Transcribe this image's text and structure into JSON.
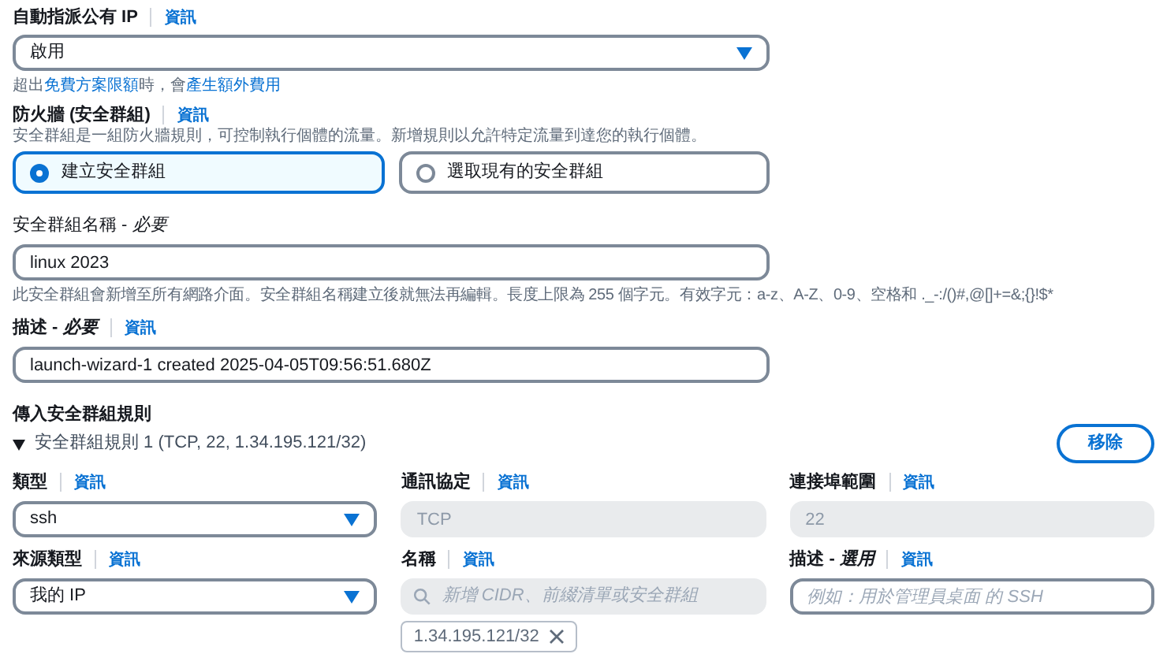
{
  "auto_public_ip": {
    "label": "自動指派公有 IP",
    "info": "資訊",
    "value": "啟用",
    "hint": [
      {
        "kind": "text",
        "text": "超出"
      },
      {
        "kind": "link",
        "text": "免費方案限額"
      },
      {
        "kind": "text",
        "text": "時，會"
      },
      {
        "kind": "link",
        "text": "產生額外費用"
      }
    ]
  },
  "firewall": {
    "label": "防火牆 (安全群組)",
    "info": "資訊",
    "description": "安全群組是一組防火牆規則，可控制執行個體的流量。新增規則以允許特定流量到達您的執行個體。",
    "options": [
      {
        "label": "建立安全群組",
        "selected": true
      },
      {
        "label": "選取現有的安全群組",
        "selected": false
      }
    ]
  },
  "group_name": {
    "label": "安全群組名稱 - *必要*",
    "value": "linux 2023",
    "hint": "此安全群組會新增至所有網路介面。安全群組名稱建立後就無法再編輯。長度上限為 255 個字元。有效字元：a-z、A-Z、0-9、空格和 ._-:/()#,@[]+=&;{}!$*"
  },
  "description": {
    "label": "描述 - *必要*",
    "info": "資訊",
    "value": "launch-wizard-1 created 2025-04-05T09:56:51.680Z"
  },
  "inbound": {
    "title": "傳入安全群組規則",
    "rules": [
      {
        "expanded": true,
        "summary": "安全群組規則 1 (TCP, 22, 1.34.195.121/32)",
        "remove": "移除",
        "fields": [
          {
            "kind": "select",
            "label": "類型",
            "info": "資訊",
            "value": "ssh"
          },
          {
            "kind": "input",
            "label": "通訊協定",
            "info": "資訊",
            "value": "TCP",
            "disabled": true
          },
          {
            "kind": "input",
            "label": "連接埠範圍",
            "info": "資訊",
            "value": "22",
            "disabled": true
          },
          {
            "kind": "select",
            "label": "來源類型",
            "info": "資訊",
            "value": "我的 IP"
          },
          {
            "kind": "search",
            "label": "名稱",
            "info": "資訊",
            "placeholder": "新增 CIDR、前綴清單或安全群組",
            "chips": [
              "1.34.195.121/32"
            ]
          },
          {
            "kind": "input",
            "label": "描述 - *選用*",
            "info": "資訊",
            "placeholder": "例如：用於管理員桌面 的 SSH",
            "disabled": false
          }
        ]
      }
    ]
  }
}
